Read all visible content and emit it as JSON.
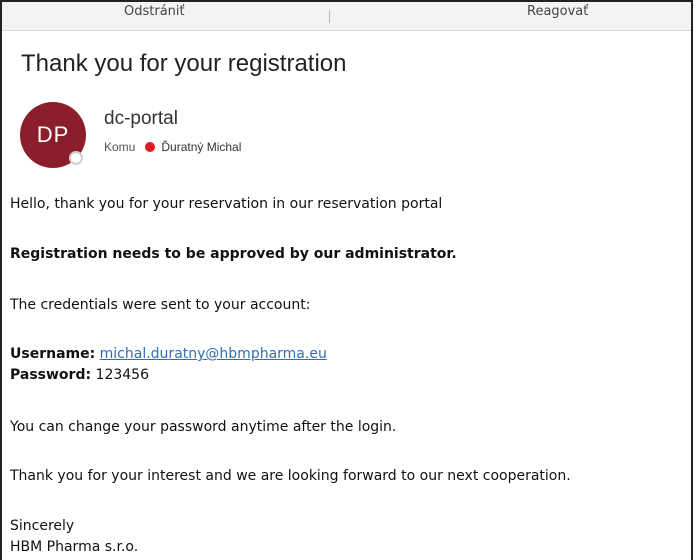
{
  "toolbar": {
    "delete_label": "Odstrániť",
    "reply_label": "Reagovať"
  },
  "message": {
    "subject": "Thank you for your registration",
    "avatar_initials": "DP",
    "sender": "dc-portal",
    "to_label": "Komu",
    "recipient": "Ďuratný Michal"
  },
  "body": {
    "greeting": "Hello, thank you for your reservation in our reservation portal",
    "approval": "Registration needs to be approved by our administrator.",
    "credentials_intro": "The credentials were sent to your account:",
    "username_label": "Username:",
    "username_value": "michal.duratny@hbmpharma.eu",
    "password_label": "Password:",
    "password_value": "123456",
    "change_password": "You can change your password anytime after the login.",
    "thanks": "Thank you for your interest and we are looking forward to our next cooperation.",
    "signoff": "Sincerely",
    "company": "HBM Pharma s.r.o."
  },
  "colors": {
    "avatar_bg": "#8b1e2b",
    "recipient_dot": "#e0191e",
    "link": "#2f6fb6",
    "toolbar_bg": "#f3f3f3"
  }
}
